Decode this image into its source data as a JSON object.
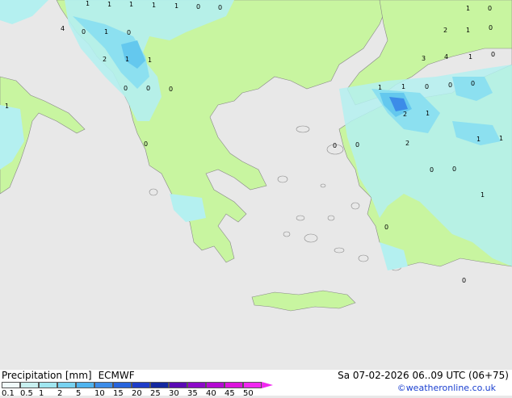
{
  "map": {
    "land_color": "#c8f5a0",
    "sea_color": "#e8e8e8",
    "precip_colors": [
      "#b4f0f0",
      "#8ce0f0",
      "#64c8ee",
      "#3c8ce8",
      "#2850d0"
    ],
    "values": [
      "1",
      "1",
      "1",
      "1",
      "1",
      "0",
      "0",
      "4",
      "0",
      "1",
      "0",
      "2",
      "1",
      "1",
      "0",
      "0",
      "0",
      "1",
      "0",
      "2",
      "1",
      "0",
      "3",
      "4",
      "1",
      "0",
      "1",
      "1",
      "0",
      "0",
      "0",
      "1",
      "2",
      "1",
      "1",
      "1",
      "0",
      "2",
      "0",
      "0",
      "0",
      "0",
      "1",
      "0",
      "0"
    ]
  },
  "legend": {
    "title": "Precipitation [mm]",
    "model": "ECMWF",
    "date": "Sa 07-02-2026 06..09 UTC (06+75)",
    "credit": "©weatheronline.co.uk",
    "ticks": [
      "0.1",
      "0.5",
      "1",
      "2",
      "5",
      "10",
      "15",
      "20",
      "25",
      "30",
      "35",
      "40",
      "45",
      "50"
    ],
    "colors": [
      "#f0fafa",
      "#c8f0f0",
      "#a0e6f0",
      "#78d2f0",
      "#50b4ee",
      "#3c8ce8",
      "#2864dc",
      "#1e3cc8",
      "#1428a0",
      "#5a0ab4",
      "#8c0ac8",
      "#b40ad2",
      "#dc14dc",
      "#f028f0"
    ]
  }
}
